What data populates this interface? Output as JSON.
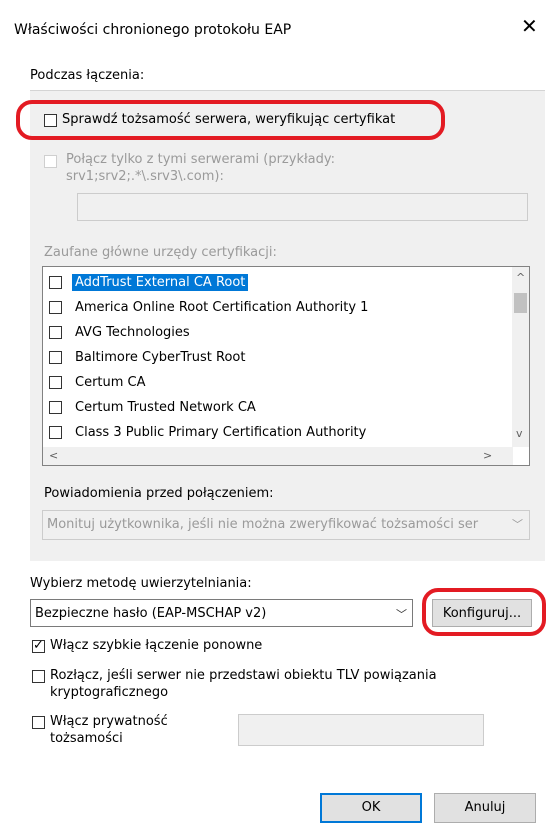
{
  "dialog": {
    "title": "Właściwości chronionego protokołu EAP",
    "close": "✕"
  },
  "connecting": {
    "heading": "Podczas łączenia:",
    "verify_cert": "Sprawdź tożsamość serwera, weryfikując certyfikat",
    "connect_servers": "Połącz tylko z tymi serwerami (przykłady: srv1;srv2;.*\\.srv3\\.com):",
    "servers_value": ""
  },
  "trusted_ca": {
    "label": "Zaufane główne urzędy certyfikacji:",
    "items": [
      {
        "label": "AddTrust External CA Root",
        "checked": false,
        "selected": true
      },
      {
        "label": "America Online Root Certification Authority 1",
        "checked": false
      },
      {
        "label": "AVG Technologies",
        "checked": false
      },
      {
        "label": "Baltimore CyberTrust Root",
        "checked": false
      },
      {
        "label": "Certum CA",
        "checked": false
      },
      {
        "label": "Certum Trusted Network CA",
        "checked": false
      },
      {
        "label": "Class 3 Public Primary Certification Authority",
        "checked": false
      }
    ],
    "scroll_up": "^",
    "scroll_down": "v",
    "scroll_left": "<",
    "scroll_right": ">"
  },
  "notifications": {
    "label": "Powiadomienia przed połączeniem:",
    "value": "Monituj użytkownika, jeśli nie można zweryfikować tożsamości ser",
    "arrow": "﹀"
  },
  "auth": {
    "label": "Wybierz metodę uwierzytelniania:",
    "method": "Bezpieczne hasło (EAP-MSCHAP v2)",
    "arrow": "﹀",
    "configure": "Konfiguruj..."
  },
  "options": {
    "fast_reconnect": "Włącz szybkie łączenie ponowne",
    "disconnect_tlv": "Rozłącz, jeśli serwer nie przedstawi obiektu TLV powiązania kryptograficznego",
    "identity_privacy": "Włącz prywatność tożsamości",
    "identity_value": ""
  },
  "buttons": {
    "ok": "OK",
    "cancel": "Anuluj"
  },
  "colors": {
    "highlight_red": "#e31b23",
    "selection_blue": "#0078d7"
  }
}
